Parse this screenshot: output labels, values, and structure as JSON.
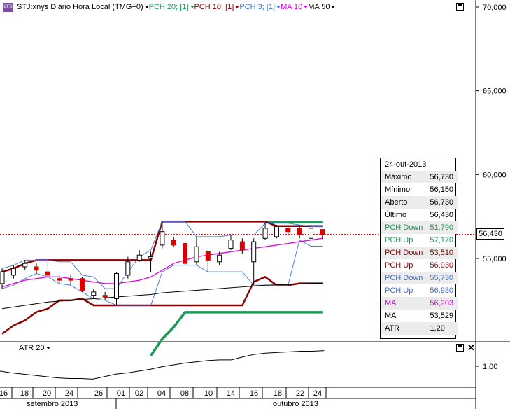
{
  "header": {
    "symbol": "STJ:xnys Diário Hora Local (TMG+0)",
    "indicators": [
      {
        "label": "PCH 20; [1]",
        "color": "#1a9a55"
      },
      {
        "label": "PCH 10; [1]",
        "color": "#8b0000"
      },
      {
        "label": "PCH 3; [1]",
        "color": "#3a6fd8"
      },
      {
        "label": "MA 10",
        "color": "#e000e0"
      },
      {
        "label": "MA 50",
        "color": "#000000"
      }
    ],
    "icon": "cfd-icon"
  },
  "current_price": "56,430",
  "atr_panel": {
    "label": "ATR 20",
    "axis_label": "1,00"
  },
  "info": {
    "date": "24-out-2013",
    "rows": [
      {
        "name": "Máximo",
        "value": "56,730",
        "color": "#000000"
      },
      {
        "name": "Mínimo",
        "value": "56,150",
        "color": "#000000"
      },
      {
        "name": "Aberto",
        "value": "56,730",
        "color": "#000000"
      },
      {
        "name": "Último",
        "value": "56,430",
        "color": "#000000"
      },
      {
        "name": "PCH Down",
        "value": "51,790",
        "color": "#1a9a55"
      },
      {
        "name": "PCH Up",
        "value": "57,170",
        "color": "#1a9a55"
      },
      {
        "name": "PCH Down",
        "value": "53,510",
        "color": "#8b0000"
      },
      {
        "name": "PCH Up",
        "value": "56,930",
        "color": "#8b0000"
      },
      {
        "name": "PCH Down",
        "value": "55,730",
        "color": "#3a6fd8"
      },
      {
        "name": "PCH Up",
        "value": "56,930",
        "color": "#3a6fd8"
      },
      {
        "name": "MA",
        "value": "56,203",
        "color": "#e000e0"
      },
      {
        "name": "MA",
        "value": "53,529",
        "color": "#000000"
      },
      {
        "name": "ATR",
        "value": "1,20",
        "color": "#000000"
      }
    ]
  },
  "x_axis": {
    "ticks": [
      "16",
      "18",
      "20",
      "24",
      "26",
      "01",
      "02",
      "04",
      "08",
      "10",
      "14",
      "16",
      "18",
      "22",
      "24"
    ],
    "months": [
      "setembro 2013",
      "outubro 2013"
    ]
  },
  "chart_data": {
    "type": "candlestick",
    "ylim": [
      51000,
      70000
    ],
    "yticks": [
      "70,000",
      "65,000",
      "60,000",
      "55,000"
    ],
    "ytick_values": [
      70000,
      65000,
      60000,
      55000
    ],
    "last_price_line": 56430,
    "candles": [
      {
        "date": "16-set",
        "o": 53500,
        "c": 54200,
        "h": 54400,
        "l": 53200
      },
      {
        "date": "17-set",
        "o": 54000,
        "c": 54400,
        "h": 54600,
        "l": 53800
      },
      {
        "date": "18-set",
        "o": 54500,
        "c": 54700,
        "h": 54900,
        "l": 54300
      },
      {
        "date": "19-set",
        "o": 54500,
        "c": 54300,
        "h": 54700,
        "l": 54100
      },
      {
        "date": "20-set",
        "o": 54200,
        "c": 54000,
        "h": 54800,
        "l": 53900
      },
      {
        "date": "23-set",
        "o": 53800,
        "c": 53700,
        "h": 54000,
        "l": 53500
      },
      {
        "date": "24-set",
        "o": 53800,
        "c": 53700,
        "h": 54000,
        "l": 53400
      },
      {
        "date": "25-set",
        "o": 53800,
        "c": 53100,
        "h": 53900,
        "l": 53000
      },
      {
        "date": "26-set",
        "o": 52800,
        "c": 53000,
        "h": 53200,
        "l": 52600
      },
      {
        "date": "27-set",
        "o": 52800,
        "c": 52700,
        "h": 53000,
        "l": 52500
      },
      {
        "date": "30-set",
        "o": 52600,
        "c": 54100,
        "h": 54200,
        "l": 52200
      },
      {
        "date": "01-out",
        "o": 54000,
        "c": 54800,
        "h": 55100,
        "l": 53800
      },
      {
        "date": "02-out",
        "o": 54900,
        "c": 55200,
        "h": 55500,
        "l": 54800
      },
      {
        "date": "03-out",
        "o": 55000,
        "c": 55100,
        "h": 55400,
        "l": 54200
      },
      {
        "date": "04-out",
        "o": 55800,
        "c": 56600,
        "h": 57200,
        "l": 55600
      },
      {
        "date": "07-out",
        "o": 56100,
        "c": 55800,
        "h": 56300,
        "l": 55700
      },
      {
        "date": "08-out",
        "o": 55900,
        "c": 54700,
        "h": 56000,
        "l": 54600
      },
      {
        "date": "09-out",
        "o": 54800,
        "c": 55700,
        "h": 56300,
        "l": 54600
      },
      {
        "date": "10-out",
        "o": 55400,
        "c": 54900,
        "h": 55500,
        "l": 54200
      },
      {
        "date": "11-out",
        "o": 54800,
        "c": 55200,
        "h": 55400,
        "l": 54600
      },
      {
        "date": "14-out",
        "o": 55600,
        "c": 56100,
        "h": 56400,
        "l": 55500
      },
      {
        "date": "15-out",
        "o": 56000,
        "c": 55500,
        "h": 56200,
        "l": 55300
      },
      {
        "date": "16-out",
        "o": 54800,
        "c": 56000,
        "h": 56200,
        "l": 53400
      },
      {
        "date": "17-out",
        "o": 56200,
        "c": 56800,
        "h": 57100,
        "l": 56100
      },
      {
        "date": "18-out",
        "o": 56300,
        "c": 56900,
        "h": 57000,
        "l": 56200
      },
      {
        "date": "21-out",
        "o": 56800,
        "c": 56600,
        "h": 56900,
        "l": 56400
      },
      {
        "date": "22-out",
        "o": 56800,
        "c": 56400,
        "h": 56900,
        "l": 56200
      },
      {
        "date": "23-out",
        "o": 56200,
        "c": 56800,
        "h": 56900,
        "l": 56100
      },
      {
        "date": "24-out",
        "o": 56730,
        "c": 56430,
        "h": 56730,
        "l": 56150
      }
    ],
    "series": [
      {
        "name": "PCH 20 Up",
        "color": "#1a9a55",
        "values": [
          null,
          null,
          null,
          null,
          null,
          null,
          null,
          null,
          null,
          null,
          null,
          null,
          null,
          null,
          null,
          null,
          null,
          null,
          null,
          null,
          null,
          null,
          null,
          57170,
          57170,
          57170,
          57170,
          57170,
          57170
        ]
      },
      {
        "name": "PCH 20 Down",
        "color": "#1a9a55",
        "values": [
          null,
          null,
          null,
          null,
          null,
          null,
          null,
          null,
          null,
          null,
          null,
          null,
          null,
          49200,
          50200,
          50900,
          51790,
          51790,
          51790,
          51790,
          51790,
          51790,
          51790,
          51790,
          51790,
          51790,
          51790,
          51790,
          51790
        ]
      },
      {
        "name": "PCH 10 Up",
        "color": "#8b0000",
        "values": [
          54200,
          54400,
          54700,
          54900,
          54900,
          54900,
          54900,
          54900,
          54900,
          54900,
          54900,
          54900,
          54900,
          54900,
          57200,
          57200,
          57200,
          57200,
          57200,
          57200,
          57200,
          57200,
          57200,
          57200,
          56930,
          56930,
          56930,
          56930,
          56930
        ]
      },
      {
        "name": "PCH 10 Down",
        "color": "#8b0000",
        "values": [
          50500,
          51000,
          51300,
          51800,
          52000,
          52500,
          52500,
          52600,
          52200,
          52200,
          52200,
          52200,
          52200,
          52200,
          52200,
          52200,
          52200,
          52200,
          52200,
          52200,
          52200,
          52200,
          53600,
          53900,
          53400,
          53400,
          53510,
          53510,
          53510
        ]
      },
      {
        "name": "PCH 3 Up",
        "color": "#3a6fd8",
        "values": [
          54400,
          54600,
          54900,
          54900,
          54900,
          54800,
          54800,
          54000,
          53900,
          53200,
          53200,
          54200,
          55100,
          55500,
          57200,
          57200,
          57200,
          56300,
          56300,
          56300,
          56400,
          56400,
          56400,
          57100,
          57100,
          57100,
          57000,
          56930,
          56930
        ]
      },
      {
        "name": "PCH 3 Down",
        "color": "#3a6fd8",
        "values": [
          53200,
          53400,
          53800,
          54100,
          53900,
          53500,
          53400,
          53000,
          52600,
          52500,
          52200,
          52200,
          52200,
          52200,
          54200,
          54600,
          54600,
          54600,
          54200,
          54200,
          54200,
          54200,
          53400,
          53400,
          53400,
          53400,
          56100,
          55730,
          55730
        ]
      },
      {
        "name": "MA 10",
        "color": "#e000e0",
        "values": [
          53300,
          53500,
          53700,
          53800,
          53900,
          53900,
          53800,
          53700,
          53600,
          53500,
          53500,
          53600,
          53700,
          53900,
          54300,
          54700,
          54900,
          55100,
          55200,
          55300,
          55400,
          55500,
          55600,
          55700,
          55800,
          55900,
          56000,
          56100,
          56203
        ]
      },
      {
        "name": "MA 50",
        "color": "#000000",
        "values": [
          52000,
          52100,
          52200,
          52300,
          52400,
          52450,
          52500,
          52550,
          52600,
          52650,
          52700,
          52750,
          52800,
          52850,
          52950,
          53000,
          53050,
          53100,
          53150,
          53200,
          53250,
          53300,
          53350,
          53400,
          53430,
          53450,
          53480,
          53510,
          53529
        ]
      }
    ],
    "atr": {
      "name": "ATR 20",
      "ylim": [
        0.7,
        1.4
      ],
      "yticks": [
        "1,00"
      ],
      "values": [
        0.95,
        0.92,
        0.9,
        0.88,
        0.86,
        0.84,
        0.83,
        0.83,
        0.82,
        0.86,
        0.9,
        0.92,
        0.95,
        0.98,
        1.02,
        1.05,
        1.08,
        1.1,
        1.12,
        1.13,
        1.13,
        1.18,
        1.22,
        1.24,
        1.25,
        1.26,
        1.27,
        1.27,
        1.28
      ]
    }
  }
}
